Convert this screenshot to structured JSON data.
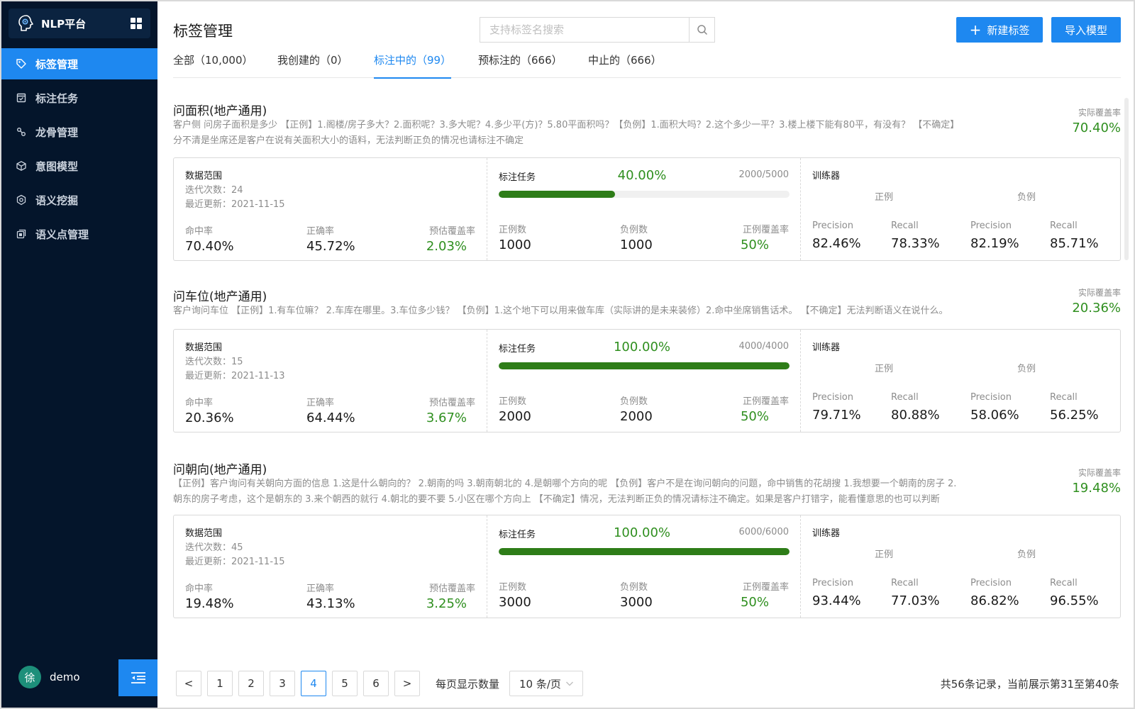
{
  "app": {
    "name": "NLP平台"
  },
  "sidebar": {
    "items": [
      {
        "label": "标签管理",
        "icon": "tag-icon",
        "active": true
      },
      {
        "label": "标注任务",
        "icon": "task-icon",
        "active": false
      },
      {
        "label": "龙骨管理",
        "icon": "keel-icon",
        "active": false
      },
      {
        "label": "意图模型",
        "icon": "cube-icon",
        "active": false
      },
      {
        "label": "语义挖掘",
        "icon": "mining-icon",
        "active": false
      },
      {
        "label": "语义点管理",
        "icon": "semantic-point-icon",
        "active": false
      }
    ],
    "user": {
      "avatar": "徐",
      "name": "demo"
    }
  },
  "header": {
    "title": "标签管理",
    "search_placeholder": "支持标签名搜索",
    "new_label": "新建标签",
    "import_label": "导入模型"
  },
  "tabs": [
    {
      "label": "全部（10,000）",
      "active": false
    },
    {
      "label": "我创建的（0）",
      "active": false
    },
    {
      "label": "标注中的（99）",
      "active": true
    },
    {
      "label": "预标注的（666）",
      "active": false
    },
    {
      "label": "中止的（666）",
      "active": false
    }
  ],
  "labels_common": {
    "coverage_label": "实际覆盖率",
    "data_range": "数据范围",
    "iter_prefix": "迭代次数：",
    "update_prefix": "最近更新：",
    "hit_rate": "命中率",
    "accuracy": "正确率",
    "est_coverage": "预估覆盖率",
    "task_title": "标注任务",
    "pos_count": "正例数",
    "neg_count": "负例数",
    "pos_coverage": "正例覆盖率",
    "trainer": "训练器",
    "positive": "正例",
    "negative": "负例",
    "precision": "Precision",
    "recall": "Recall"
  },
  "labels": [
    {
      "title": "问面积(地产通用)",
      "desc": "客户侧 问房子面积是多少 【正例】1.阁楼/房子多大？2.面积呢？3.多大呢？4.多少平(方)？5.80平面积吗？【负例】1.面积大吗？2.这个多少一平？3.楼上楼下能有80平，有没有？ 【不确定】分不清是坐席还是客户在说有关面积大小的语料，无法判断正负的情况也请标注不确定",
      "coverage": "70.40%",
      "iterations": "24",
      "updated": "2021-11-15",
      "hit_rate": "70.40%",
      "accuracy": "45.72%",
      "est_coverage": "2.03%",
      "task_percent": "40.00%",
      "task_progress": 0.4,
      "task_count": "2000/5000",
      "pos_count": "1000",
      "neg_count": "1000",
      "pos_coverage": "50%",
      "pos_precision": "82.46%",
      "pos_recall": "78.33%",
      "neg_precision": "82.19%",
      "neg_recall": "85.71%"
    },
    {
      "title": "问车位(地产通用)",
      "desc": "客户询问车位 【正例】1.有车位嘛？ 2.车库在哪里。3.车位多少钱？ 【负例】1.这个地下可以用来做车库（实际讲的是未来装修）2.命中坐席销售话术。 【不确定】无法判断语义在说什么。",
      "coverage": "20.36%",
      "iterations": "15",
      "updated": "2021-11-13",
      "hit_rate": "20.36%",
      "accuracy": "64.44%",
      "est_coverage": "3.67%",
      "task_percent": "100.00%",
      "task_progress": 1.0,
      "task_count": "4000/4000",
      "pos_count": "2000",
      "neg_count": "2000",
      "pos_coverage": "50%",
      "pos_precision": "79.71%",
      "pos_recall": "80.88%",
      "neg_precision": "58.06%",
      "neg_recall": "56.25%"
    },
    {
      "title": "问朝向(地产通用)",
      "desc": "【正例】客户询问有关朝向方面的信息 1.这是什么朝向的？ 2.朝南的吗 3.朝南朝北的 4.是朝哪个方向的呢 【负例】客户不是在询问朝向的问题，命中销售的花胡搜 1.我想要一个朝南的房子 2.朝东的房子考虑，这个是朝东的 3.来个朝西的就行 4.朝北的要不要 5.小区在哪个方向上 【不确定】情况，无法判断正负的情况请标注不确定。如果是客户打错字，能看懂意思的也可以判断",
      "coverage": "19.48%",
      "iterations": "45",
      "updated": "2021-11-15",
      "hit_rate": "19.48%",
      "accuracy": "43.13%",
      "est_coverage": "3.25%",
      "task_percent": "100.00%",
      "task_progress": 1.0,
      "task_count": "6000/6000",
      "pos_count": "3000",
      "neg_count": "3000",
      "pos_coverage": "50%",
      "pos_precision": "93.44%",
      "pos_recall": "77.03%",
      "neg_precision": "86.82%",
      "neg_recall": "96.55%"
    }
  ],
  "pagination": {
    "prev": "<",
    "next": ">",
    "pages": [
      "1",
      "2",
      "3",
      "4",
      "5",
      "6"
    ],
    "current": "4",
    "page_size_label": "每页显示数量",
    "page_size": "10 条/页",
    "info": "共56条记录，当前展示第31至第40条"
  },
  "colors": {
    "accent": "#1e88f0",
    "sidebar": "#04152b",
    "success": "#2f8f1f",
    "progress": "#2e7d18"
  }
}
